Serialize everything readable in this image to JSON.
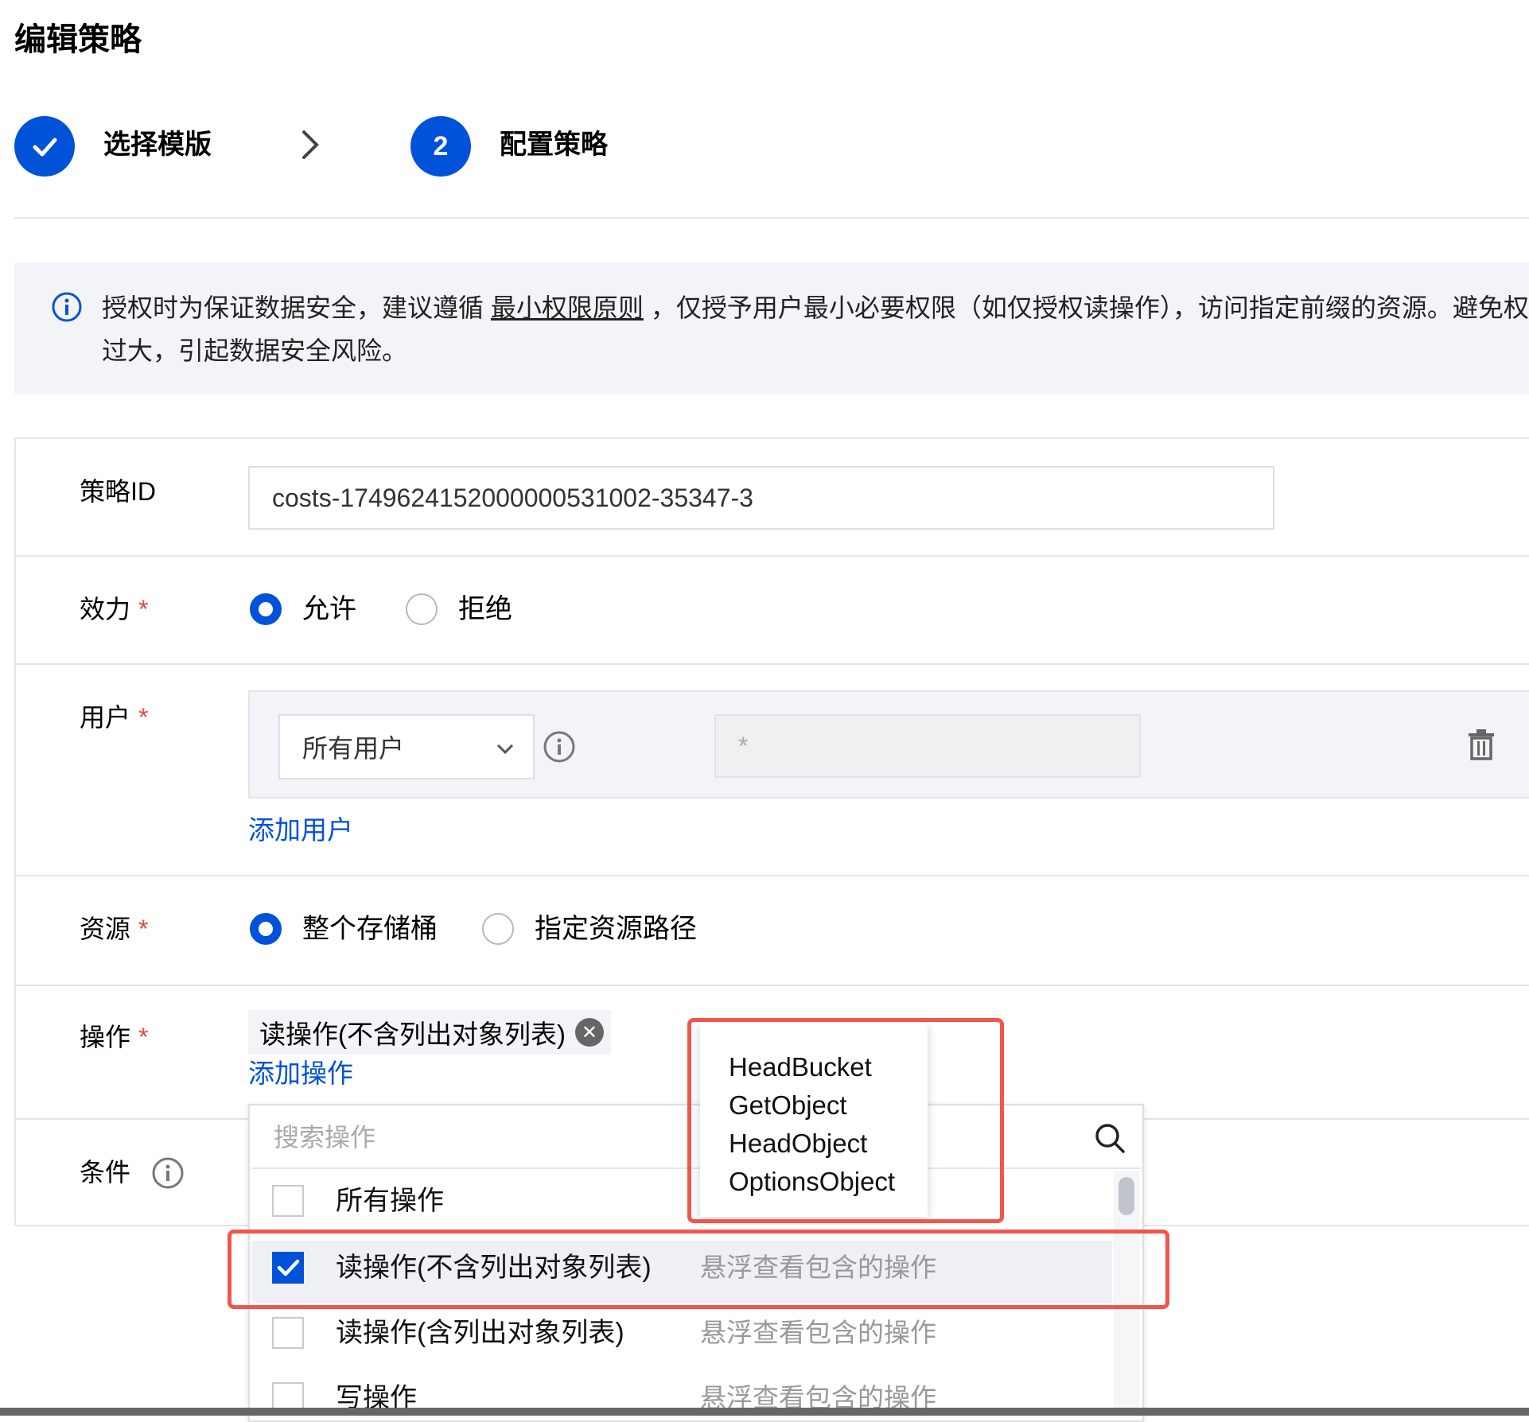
{
  "page_title": "编辑策略",
  "steps": [
    {
      "label": "选择模版",
      "state": "done"
    },
    {
      "label": "配置策略",
      "number": "2",
      "state": "active"
    }
  ],
  "notice": {
    "prefix": "授权时为保证数据安全，建议遵循 ",
    "link": "最小权限原则",
    "suffix": " ，仅授予用户最小必要权限（如仅授权读操作），访问指定前缀的资源。避免权",
    "line2": "过大，引起数据安全风险。"
  },
  "form": {
    "policy_id": {
      "label": "策略ID",
      "value": "costs-1749624152000000531002-35347-3"
    },
    "effect": {
      "label": "效力",
      "required": "*",
      "options": [
        {
          "label": "允许",
          "selected": true
        },
        {
          "label": "拒绝",
          "selected": false
        }
      ]
    },
    "user": {
      "label": "用户",
      "required": "*",
      "select_value": "所有用户",
      "input_placeholder": "*",
      "add_link": "添加用户"
    },
    "resource": {
      "label": "资源",
      "required": "*",
      "options": [
        {
          "label": "整个存储桶",
          "selected": true
        },
        {
          "label": "指定资源路径",
          "selected": false
        }
      ]
    },
    "action": {
      "label": "操作",
      "required": "*",
      "tag": "读操作(不含列出对象列表)",
      "add_link": "添加操作"
    },
    "condition": {
      "label": "条件"
    }
  },
  "dropdown": {
    "search_placeholder": "搜索操作",
    "items": [
      {
        "label": "所有操作",
        "checked": false,
        "hint": ""
      },
      {
        "label": "读操作(不含列出对象列表)",
        "checked": true,
        "hint": "悬浮查看包含的操作"
      },
      {
        "label": "读操作(含列出对象列表)",
        "checked": false,
        "hint": "悬浮查看包含的操作"
      },
      {
        "label": "写操作",
        "checked": false,
        "hint": "悬浮查看包含的操作"
      }
    ]
  },
  "tooltip": {
    "items": [
      "HeadBucket",
      "GetObject",
      "HeadObject",
      "OptionsObject"
    ]
  },
  "colors": {
    "primary": "#0052d9",
    "required": "#e54545",
    "highlight": "#f0564d"
  }
}
